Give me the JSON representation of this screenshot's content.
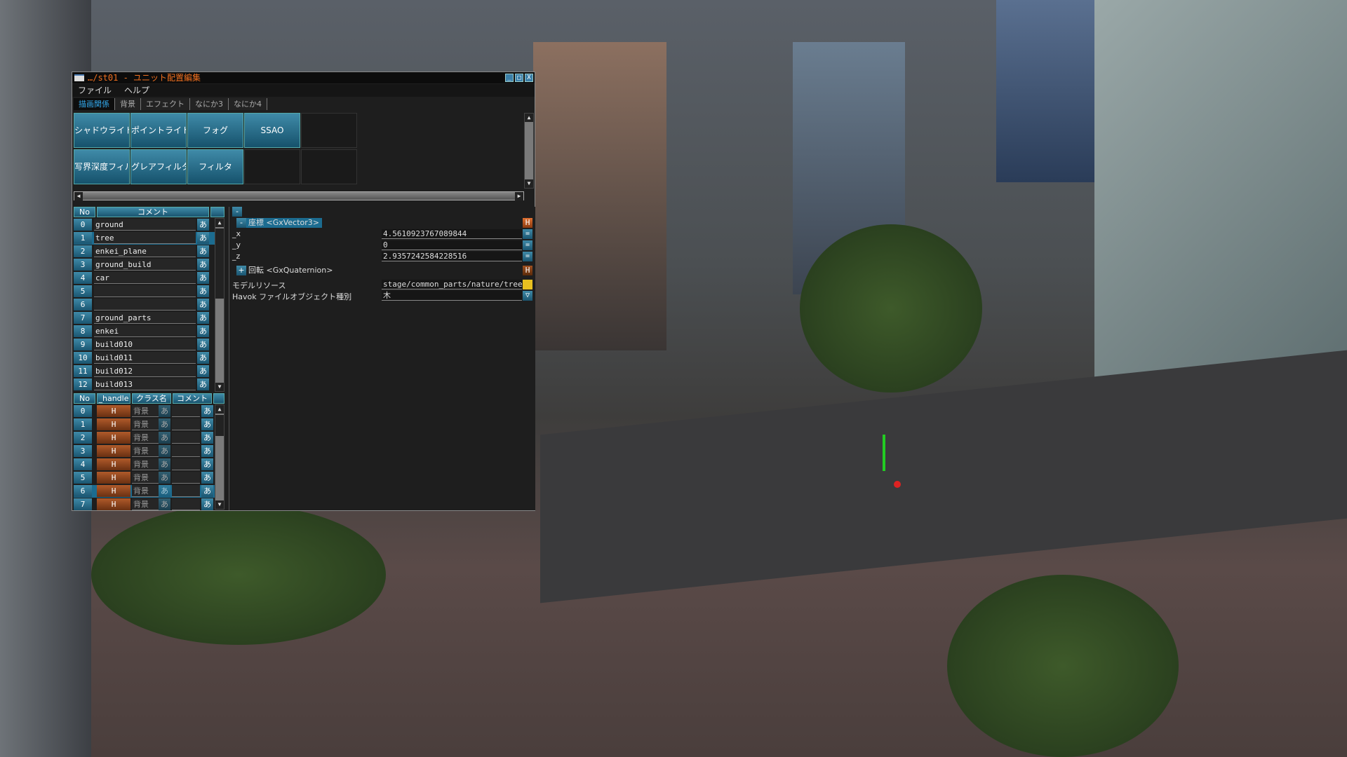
{
  "window": {
    "title": "…/st01 - ユニット配置編集",
    "min": "_",
    "max": "□",
    "close": "X"
  },
  "menu": [
    "ファイル",
    "ヘルプ"
  ],
  "tabs": [
    {
      "label": "描画関係",
      "active": true
    },
    {
      "label": "背景"
    },
    {
      "label": "エフェクト"
    },
    {
      "label": "なにか3"
    },
    {
      "label": "なにか4"
    }
  ],
  "buttons": [
    "シャドウライト",
    "ポイントライト",
    "フォグ",
    "SSAO",
    "写界深度フィルタ",
    "グレアフィルタ",
    "フィルタ"
  ],
  "unit_list": {
    "headers": {
      "no": "No",
      "comment": "コメント"
    },
    "ime_label": "あ",
    "selected": 1,
    "rows": [
      [
        "0",
        "ground"
      ],
      [
        "1",
        "tree"
      ],
      [
        "2",
        "enkei_plane"
      ],
      [
        "3",
        "ground_build"
      ],
      [
        "4",
        "car"
      ],
      [
        "5",
        ""
      ],
      [
        "6",
        ""
      ],
      [
        "7",
        "ground_parts"
      ],
      [
        "8",
        "enkei"
      ],
      [
        "9",
        "build010"
      ],
      [
        "10",
        "build011"
      ],
      [
        "11",
        "build012"
      ],
      [
        "12",
        "build013"
      ]
    ]
  },
  "object_list": {
    "headers": {
      "no": "No",
      "handle": "_handle",
      "class": "クラス名",
      "comment": "コメント"
    },
    "handle_label": "H",
    "ime_label": "あ",
    "selected": 6,
    "rows": [
      [
        "0",
        "背景"
      ],
      [
        "1",
        "背景"
      ],
      [
        "2",
        "背景"
      ],
      [
        "3",
        "背景"
      ],
      [
        "4",
        "背景"
      ],
      [
        "5",
        "背景"
      ],
      [
        "6",
        "背景"
      ],
      [
        "7",
        "背景"
      ]
    ]
  },
  "properties": {
    "collapse": "-",
    "position": {
      "toggle": "-",
      "label": "座標 <GxVector3>",
      "h": "H",
      "fields": [
        {
          "label": "_x",
          "value": "4.5610923767089844"
        },
        {
          "label": "_y",
          "value": "0"
        },
        {
          "label": "_z",
          "value": "2.9357242584228516"
        }
      ],
      "eq": "="
    },
    "rotation": {
      "toggle": "+",
      "label": "回転 <GxQuaternion>",
      "h": "H"
    },
    "model_resource": {
      "label": "モデルリソース",
      "value": "stage/common_parts/nature/tree/tre"
    },
    "havok_type": {
      "label": "Havok ファイルオブジェクト種別",
      "value": "木"
    }
  },
  "colors": {
    "accent": "#3f8aa8",
    "handle": "#b05a2a",
    "title": "#f07020"
  }
}
